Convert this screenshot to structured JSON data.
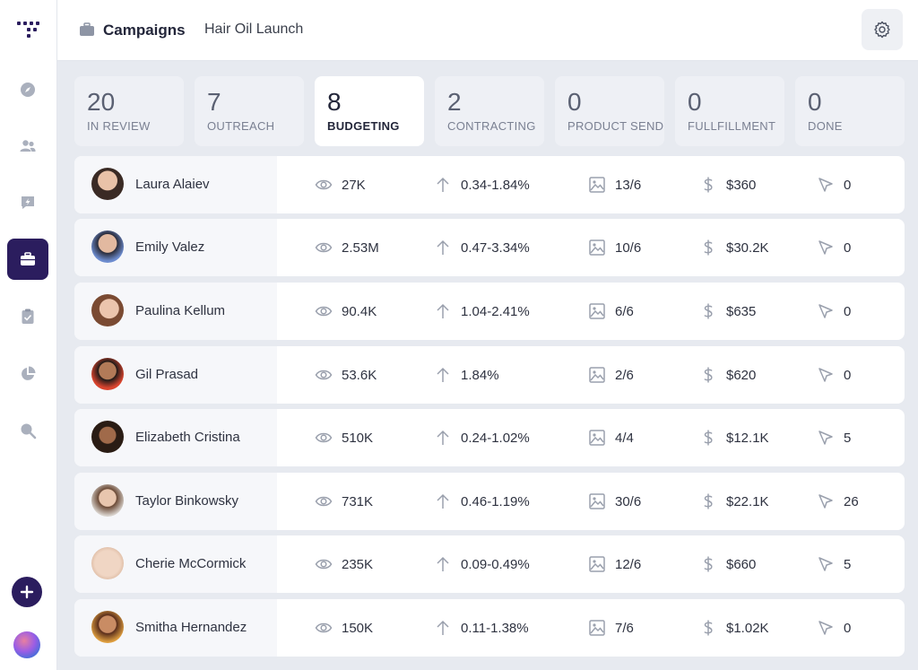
{
  "nav": {
    "items": [
      "logo-icon",
      "compass-icon",
      "users-icon",
      "campaign-flash-icon",
      "briefcase-icon",
      "clipboard-icon",
      "pie-chart-icon",
      "search-icon"
    ],
    "active": "briefcase-icon",
    "accent": "#2b1d5e"
  },
  "header": {
    "section": "Campaigns",
    "campaign": "Hair Oil Launch"
  },
  "stages": [
    {
      "count": "20",
      "label": "IN REVIEW"
    },
    {
      "count": "7",
      "label": "OUTREACH"
    },
    {
      "count": "8",
      "label": "BUDGETING"
    },
    {
      "count": "2",
      "label": "CONTRACTING"
    },
    {
      "count": "0",
      "label": "PRODUCT SEND"
    },
    {
      "count": "0",
      "label": "FULLFILLMENT"
    },
    {
      "count": "0",
      "label": "DONE"
    }
  ],
  "active_stage": "BUDGETING",
  "rows": [
    {
      "name": "Laura Alaiev",
      "views": "27K",
      "engagement": "0.34-1.84%",
      "posts": "13/6",
      "cost": "$360",
      "clicks": "0"
    },
    {
      "name": "Emily Valez",
      "views": "2.53M",
      "engagement": "0.47-3.34%",
      "posts": "10/6",
      "cost": "$30.2K",
      "clicks": "0"
    },
    {
      "name": "Paulina Kellum",
      "views": "90.4K",
      "engagement": "1.04-2.41%",
      "posts": "6/6",
      "cost": "$635",
      "clicks": "0"
    },
    {
      "name": "Gil Prasad",
      "views": "53.6K",
      "engagement": "1.84%",
      "posts": "2/6",
      "cost": "$620",
      "clicks": "0"
    },
    {
      "name": "Elizabeth Cristina",
      "views": "510K",
      "engagement": "0.24-1.02%",
      "posts": "4/4",
      "cost": "$12.1K",
      "clicks": "5"
    },
    {
      "name": "Taylor Binkowsky",
      "views": "731K",
      "engagement": "0.46-1.19%",
      "posts": "30/6",
      "cost": "$22.1K",
      "clicks": "26"
    },
    {
      "name": "Cherie McCormick",
      "views": "235K",
      "engagement": "0.09-0.49%",
      "posts": "12/6",
      "cost": "$660",
      "clicks": "5"
    },
    {
      "name": "Smitha Hernandez",
      "views": "150K",
      "engagement": "0.11-1.38%",
      "posts": "7/6",
      "cost": "$1.02K",
      "clicks": "0"
    }
  ]
}
